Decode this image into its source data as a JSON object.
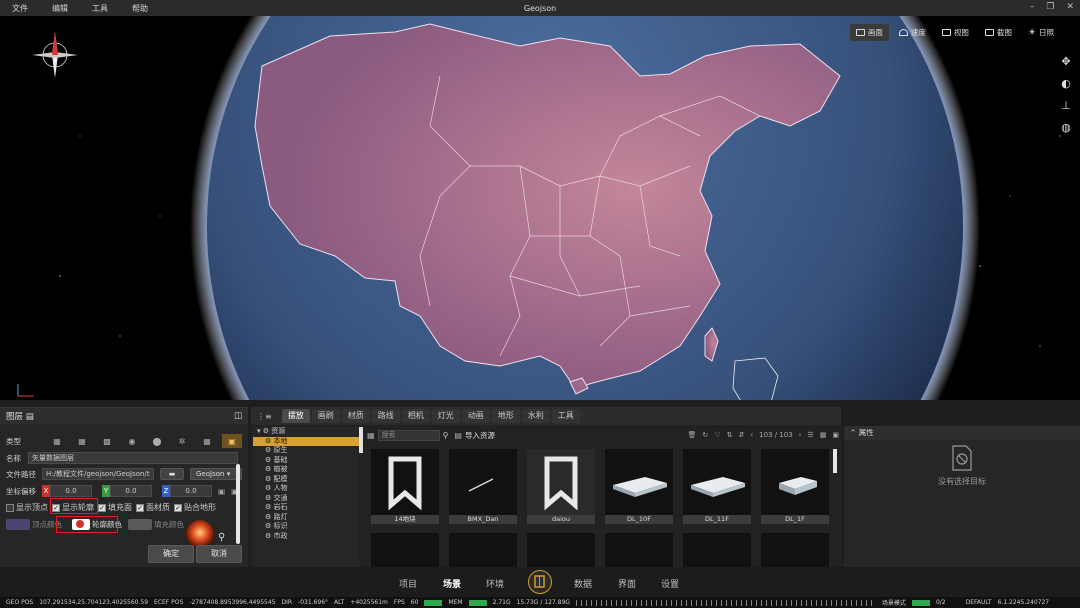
{
  "app": {
    "title": "Geojson",
    "menu": [
      "文件",
      "编辑",
      "工具",
      "帮助"
    ]
  },
  "viewport": {
    "tabs": [
      {
        "label": "画面",
        "icon": "picture-icon",
        "active": true
      },
      {
        "label": "速度",
        "icon": "speed-icon",
        "active": false
      },
      {
        "label": "视图",
        "icon": "view-icon",
        "active": false
      },
      {
        "label": "截图",
        "icon": "screenshot-icon",
        "active": false
      },
      {
        "label": "日照",
        "icon": "sun-icon",
        "active": false
      }
    ],
    "side_tools": [
      "move-icon",
      "orbit-icon",
      "axis-icon",
      "globe-icon"
    ],
    "colors": {
      "space": "#000000",
      "ocean": "#36507a",
      "land": "#9a6a88"
    }
  },
  "layer_panel": {
    "title": "图层",
    "type_label": "类型",
    "name_label": "名称",
    "name_value": "矢量数据图层",
    "path_label": "文件路径",
    "path_value": "H:/教程文件/geojson/GeoJson/t",
    "format_value": "GeoJson",
    "offset_label": "坐标偏移",
    "offset": {
      "x": "0.0",
      "y": "0.0",
      "z": "0.0"
    },
    "checks": [
      {
        "label": "显示顶点",
        "checked": false
      },
      {
        "label": "显示轮廓",
        "checked": true
      },
      {
        "label": "填充面",
        "checked": true
      },
      {
        "label": "面材质",
        "checked": true
      },
      {
        "label": "贴合地形",
        "checked": true
      }
    ],
    "vertex_color_label": "顶点颜色",
    "outline_color_label": "轮廓颜色",
    "fill_color_label": "填充颜色",
    "ok": "确定",
    "cancel": "取消",
    "colors": {
      "vertex": "#4a4470",
      "outline": "#ffffff",
      "fill": "#5a5a5a",
      "selected_type": "#6b5220"
    }
  },
  "asset_panel": {
    "tabs": [
      "摆放",
      "画刷",
      "材质",
      "路线",
      "相机",
      "灯光",
      "动画",
      "地形",
      "水利",
      "工具"
    ],
    "active_tab": "摆放",
    "tree": [
      {
        "label": "资源",
        "level": 0
      },
      {
        "label": "本地",
        "level": 1,
        "selected": true
      },
      {
        "label": "原生",
        "level": 1
      },
      {
        "label": "基础",
        "level": 1
      },
      {
        "label": "植被",
        "level": 1
      },
      {
        "label": "配模",
        "level": 1
      },
      {
        "label": "人物",
        "level": 1
      },
      {
        "label": "交通",
        "level": 1
      },
      {
        "label": "岩石",
        "level": 1
      },
      {
        "label": "路灯",
        "level": 1
      },
      {
        "label": "标识",
        "level": 1
      },
      {
        "label": "市政",
        "level": 1
      }
    ],
    "search_placeholder": "搜索",
    "import_label": "导入资源",
    "page_count": "103 / 103",
    "tiles": [
      {
        "caption": "14地块",
        "kind": "bookmark"
      },
      {
        "caption": "BMX_Dan",
        "kind": "line"
      },
      {
        "caption": "daiou",
        "kind": "bookmark"
      },
      {
        "caption": "DL_10F",
        "kind": "building"
      },
      {
        "caption": "DL_11F",
        "kind": "building"
      },
      {
        "caption": "DL_1F",
        "kind": "building"
      }
    ]
  },
  "property_panel": {
    "title": "属性",
    "empty_text": "没有选择目标"
  },
  "bottom_nav": {
    "items": [
      "项目",
      "场景",
      "环境",
      "数据",
      "界面",
      "设置"
    ],
    "active": "场景"
  },
  "status_bar": {
    "geo_pos_label": "GEO POS",
    "geo_pos": "107.291534,25.704123,4025560.59",
    "ecef_label": "ECEF POS",
    "ecef_pos": "-2787408.8953996,4495545",
    "dir_label": "DIR",
    "dir": "-031.696°",
    "alt_label": "ALT",
    "alt": "+4025561m",
    "fps_label": "FPS",
    "fps": "60",
    "mem_label": "MEM",
    "mem": "2.71G",
    "gpu": "15.73G / 127.89G",
    "mode": "场景模式",
    "count": "0/2",
    "layout": "DEFAULT",
    "version": "6.1.2245.240727"
  }
}
